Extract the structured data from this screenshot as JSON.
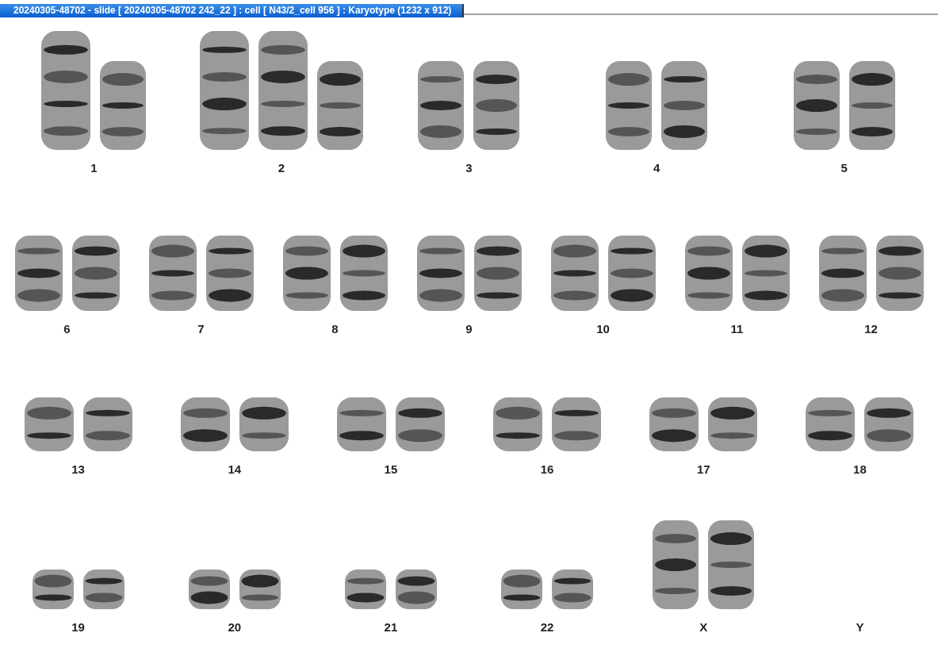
{
  "window": {
    "title": "20240305-48702 - slide [ 20240305-48702 242_22 ] : cell [ N43/2_cell 956 ] : Karyotype  (1232 x 912)"
  },
  "karyotype": {
    "rows": [
      {
        "groups": [
          {
            "label": "1",
            "chromosomes": [
              {
                "kind": "long"
              },
              {
                "kind": "medium"
              }
            ]
          },
          {
            "label": "2",
            "chromosomes": [
              {
                "kind": "long"
              },
              {
                "kind": "long"
              },
              {
                "kind": "medium"
              }
            ]
          },
          {
            "label": "3",
            "chromosomes": [
              {
                "kind": "medium"
              },
              {
                "kind": "medium"
              }
            ]
          },
          {
            "label": "4",
            "chromosomes": [
              {
                "kind": "medium"
              },
              {
                "kind": "medium"
              }
            ]
          },
          {
            "label": "5",
            "chromosomes": [
              {
                "kind": "medium"
              },
              {
                "kind": "medium"
              }
            ]
          }
        ]
      },
      {
        "groups": [
          {
            "label": "6",
            "chromosomes": [
              {
                "kind": "short"
              },
              {
                "kind": "short"
              }
            ]
          },
          {
            "label": "7",
            "chromosomes": [
              {
                "kind": "short"
              },
              {
                "kind": "short"
              }
            ]
          },
          {
            "label": "8",
            "chromosomes": [
              {
                "kind": "short"
              },
              {
                "kind": "short"
              }
            ]
          },
          {
            "label": "9",
            "chromosomes": [
              {
                "kind": "short"
              },
              {
                "kind": "short"
              }
            ]
          },
          {
            "label": "10",
            "chromosomes": [
              {
                "kind": "short"
              },
              {
                "kind": "short"
              }
            ]
          },
          {
            "label": "11",
            "chromosomes": [
              {
                "kind": "short"
              },
              {
                "kind": "short"
              }
            ]
          },
          {
            "label": "12",
            "chromosomes": [
              {
                "kind": "short"
              },
              {
                "kind": "short"
              }
            ]
          }
        ]
      },
      {
        "groups": [
          {
            "label": "13",
            "chromosomes": [
              {
                "kind": "small"
              },
              {
                "kind": "small"
              }
            ]
          },
          {
            "label": "14",
            "chromosomes": [
              {
                "kind": "small"
              },
              {
                "kind": "small"
              }
            ]
          },
          {
            "label": "15",
            "chromosomes": [
              {
                "kind": "small"
              },
              {
                "kind": "small"
              }
            ]
          },
          {
            "label": "16",
            "chromosomes": [
              {
                "kind": "small"
              },
              {
                "kind": "small"
              }
            ]
          },
          {
            "label": "17",
            "chromosomes": [
              {
                "kind": "small"
              },
              {
                "kind": "small"
              }
            ]
          },
          {
            "label": "18",
            "chromosomes": [
              {
                "kind": "small"
              },
              {
                "kind": "small"
              }
            ]
          }
        ]
      },
      {
        "groups": [
          {
            "label": "19",
            "chromosomes": [
              {
                "kind": "tiny"
              },
              {
                "kind": "tiny"
              }
            ]
          },
          {
            "label": "20",
            "chromosomes": [
              {
                "kind": "tiny"
              },
              {
                "kind": "tiny"
              }
            ]
          },
          {
            "label": "21",
            "chromosomes": [
              {
                "kind": "tiny"
              },
              {
                "kind": "tiny"
              }
            ]
          },
          {
            "label": "22",
            "chromosomes": [
              {
                "kind": "tiny"
              },
              {
                "kind": "tiny"
              }
            ]
          },
          {
            "label": "X",
            "chromosomes": [
              {
                "kind": "medium"
              },
              {
                "kind": "medium"
              }
            ]
          },
          {
            "label": "Y"
          }
        ]
      }
    ]
  }
}
